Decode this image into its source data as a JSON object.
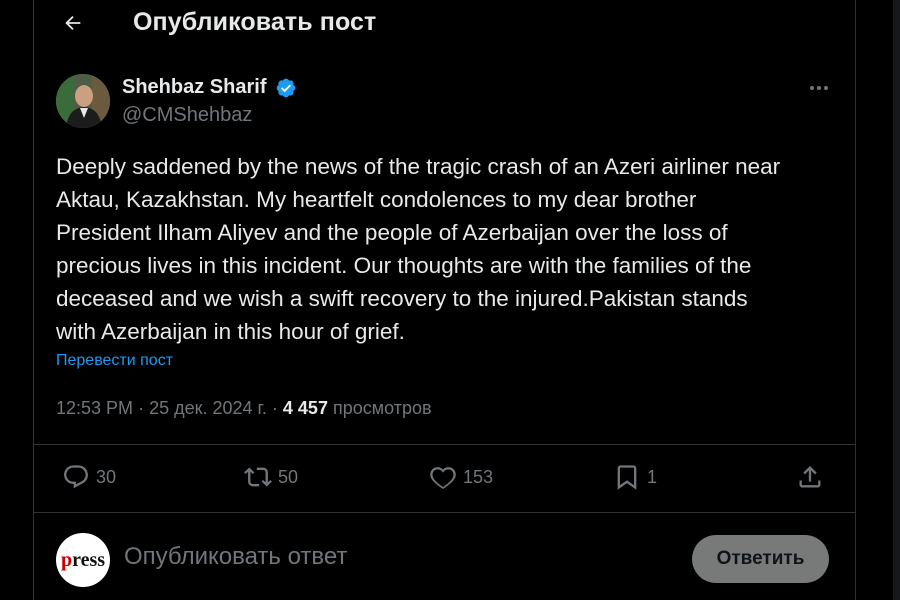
{
  "header": {
    "title": "Опубликовать пост",
    "back_icon": "arrow-left-icon"
  },
  "author": {
    "name": "Shehbaz Sharif",
    "handle": "@CMShehbaz",
    "verified_color": "#1d9bf0"
  },
  "tweet": {
    "lines": [
      "Deeply saddened by the news of the tragic crash of an Azeri airliner near",
      "Aktau, Kazakhstan. My heartfelt condolences to my dear brother",
      "President Ilham Aliyev and the people of Azerbaijan over the loss of",
      "precious lives in this incident. Our thoughts are with the families of the",
      "deceased and we wish a swift recovery to the injured.Pakistan stands",
      "with Azerbaijan in this hour of grief."
    ],
    "translate": "Перевести пост",
    "time": "12:53 PM",
    "date": "25 дек. 2024 г.",
    "views_count": "4 457",
    "views_label": "просмотров"
  },
  "actions": {
    "replies": "30",
    "reposts": "50",
    "likes": "153",
    "bookmarks": "1"
  },
  "reply": {
    "avatar_text_red": "p",
    "avatar_text": "ress",
    "placeholder": "Опубликовать ответ",
    "button": "Ответить"
  },
  "colors": {
    "accent": "#1d9bf0",
    "muted": "#71767b",
    "background": "#000000"
  }
}
